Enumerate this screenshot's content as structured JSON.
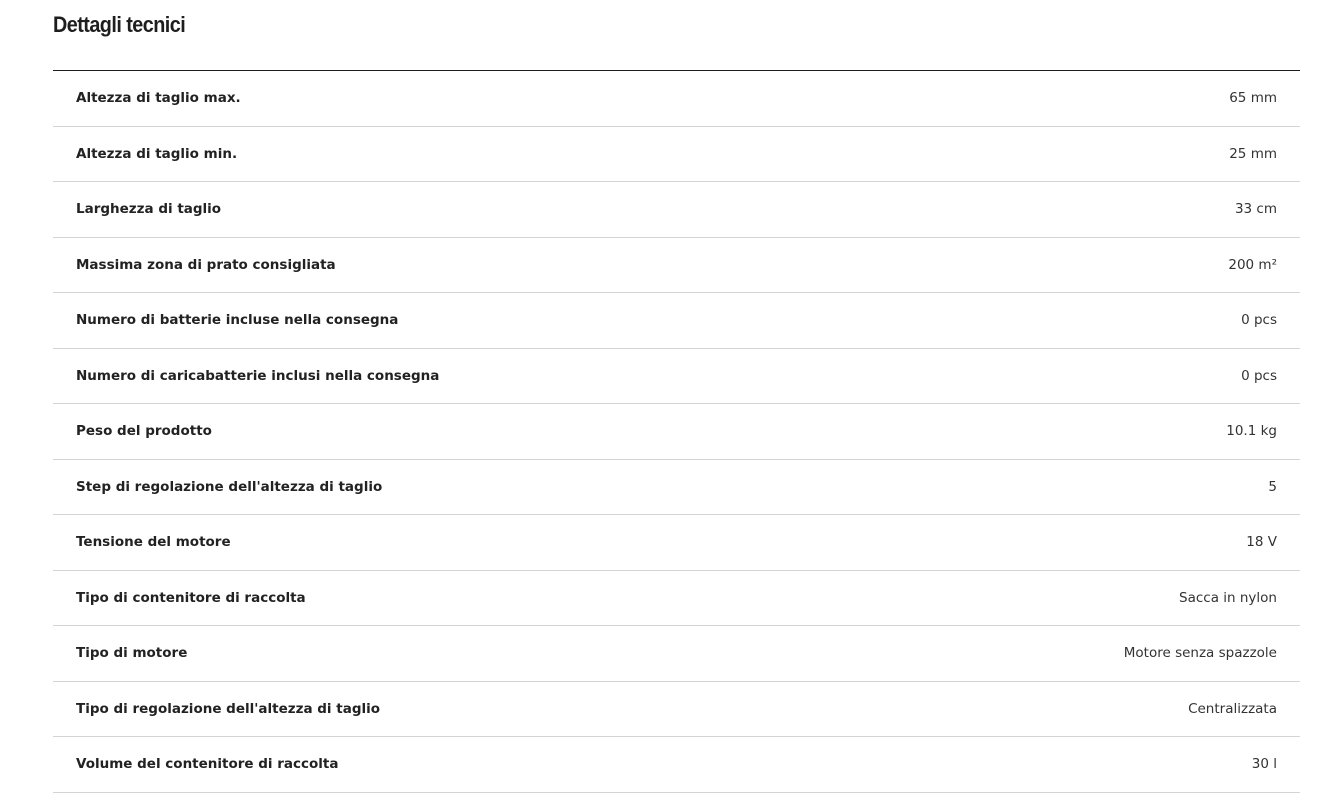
{
  "section": {
    "title": "Dettagli tecnici"
  },
  "specs": [
    {
      "label": "Altezza di taglio max.",
      "value": "65 mm"
    },
    {
      "label": "Altezza di taglio min.",
      "value": "25 mm"
    },
    {
      "label": "Larghezza di taglio",
      "value": "33 cm"
    },
    {
      "label": "Massima zona di prato consigliata",
      "value": "200 m²"
    },
    {
      "label": "Numero di batterie incluse nella consegna",
      "value": "0 pcs"
    },
    {
      "label": "Numero di caricabatterie inclusi nella consegna",
      "value": "0 pcs"
    },
    {
      "label": "Peso del prodotto",
      "value": "10.1 kg"
    },
    {
      "label": "Step di regolazione dell'altezza di taglio",
      "value": "5"
    },
    {
      "label": "Tensione del motore",
      "value": "18 V"
    },
    {
      "label": "Tipo di contenitore di raccolta",
      "value": "Sacca in nylon"
    },
    {
      "label": "Tipo di motore",
      "value": "Motore senza spazzole"
    },
    {
      "label": "Tipo di regolazione dell'altezza di taglio",
      "value": "Centralizzata"
    },
    {
      "label": "Volume del contenitore di raccolta",
      "value": "30 l"
    }
  ]
}
